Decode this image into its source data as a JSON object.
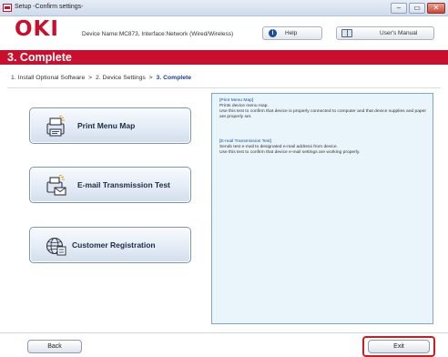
{
  "window": {
    "title": "Setup -Confirm settings-",
    "controls": [
      "–",
      "▭",
      "✕"
    ]
  },
  "header": {
    "logo": "OKI",
    "device_name": "Device Name:MC873, Interface:Network (Wired/Wireless)",
    "help_label": "Help",
    "manual_label": "User's Manual"
  },
  "page_title": "3. Complete",
  "breadcrumb": {
    "step1": "1. Install Optional Software",
    "step2": "2. Device Settings",
    "step3": "3. Complete",
    "separator": ">"
  },
  "actions": {
    "print_menu_map": "Print Menu Map",
    "email_test": "E-mail Transmission Test",
    "customer_registration": "Customer Registration"
  },
  "info": {
    "print_menu_heading": "[Print Menu Map]",
    "print_menu_line1": "Prints device menu map.",
    "print_menu_line2": "Use this test to confirm that device is properly connected to computer and that device supplies and paper are properly set.",
    "email_heading": "[E-mail Transmission Test]",
    "email_line1": "Sends test e-mail to designated e-mail address from device.",
    "email_line2": "Use this test to confirm that device e-mail settings are working properly."
  },
  "footer": {
    "back_label": "Back",
    "exit_label": "Exit"
  },
  "colors": {
    "brand_red": "#c8102e",
    "panel_bg": "#e9f5fb",
    "link_blue": "#1c4e9c"
  }
}
